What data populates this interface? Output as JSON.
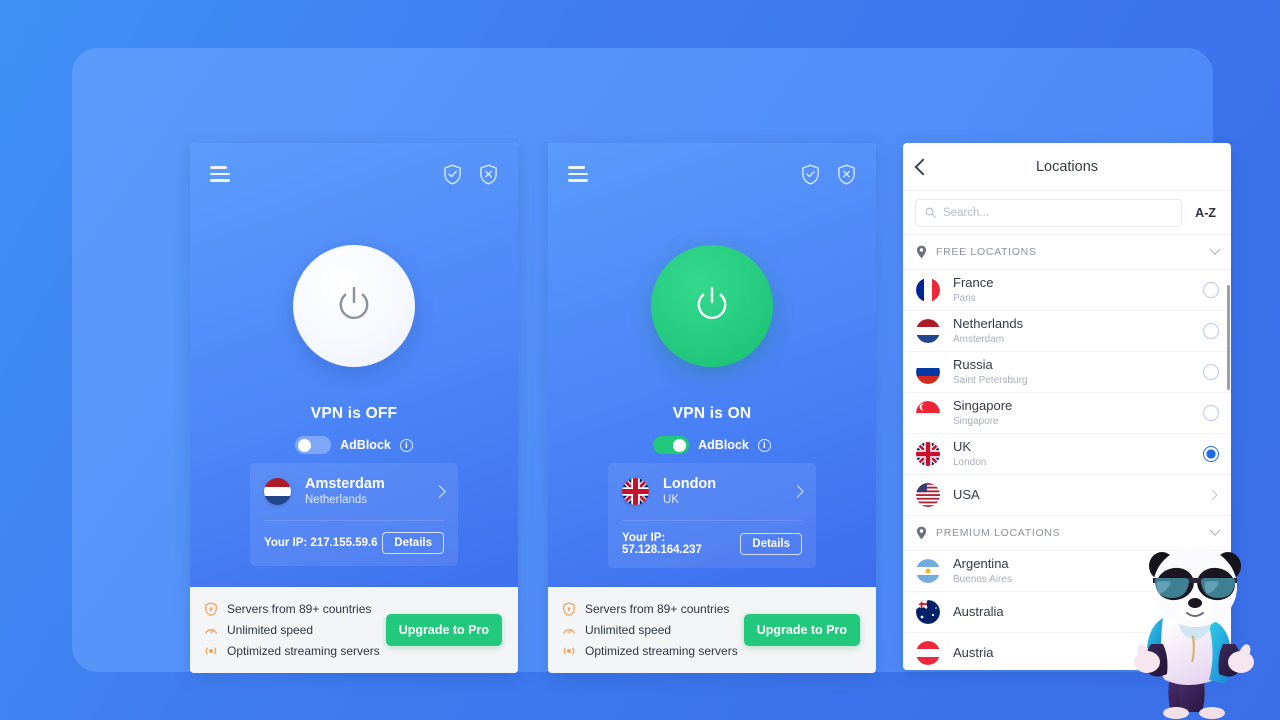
{
  "theme": {
    "page_bg_start": "#3f90f5",
    "page_bg_end": "#3b6fe8",
    "stage_bg": "#5390f9",
    "accent_green": "#22c97c",
    "accent_blue": "#1f6bef",
    "lock_red": "#e8525f",
    "perk_orange": "#f5a25d"
  },
  "panel_off": {
    "menu_icon": "hamburger-menu-icon",
    "shield_check_icon": "shield-check-icon",
    "shield_x_icon": "shield-x-icon",
    "power_icon": "power-icon",
    "power_state": "off",
    "status_text": "VPN is OFF",
    "adblock": {
      "label": "AdBlock",
      "enabled": false,
      "info_icon": "info-icon",
      "info_glyph": "i"
    },
    "server": {
      "flag": "netherlands-flag-icon",
      "city": "Amsterdam",
      "country": "Netherlands",
      "chevron_icon": "chevron-right-icon"
    },
    "ip_text": "Your IP: 217.155.59.6",
    "details_label": "Details",
    "upsell": {
      "perks": [
        {
          "icon": "shield-lock-icon",
          "label": "Servers from 89+ countries"
        },
        {
          "icon": "speedometer-icon",
          "label": "Unlimited speed"
        },
        {
          "icon": "stream-icon",
          "label": "Optimized streaming servers"
        }
      ],
      "upgrade_label": "Upgrade to Pro"
    }
  },
  "panel_on": {
    "menu_icon": "hamburger-menu-icon",
    "shield_check_icon": "shield-check-icon",
    "shield_x_icon": "shield-x-icon",
    "power_icon": "power-icon",
    "power_state": "on",
    "status_text": "VPN is ON",
    "adblock": {
      "label": "AdBlock",
      "enabled": true,
      "info_icon": "info-icon",
      "info_glyph": "i"
    },
    "server": {
      "flag": "uk-flag-icon",
      "city": "London",
      "country": "UK",
      "chevron_icon": "chevron-right-icon"
    },
    "ip_text": "Your IP: 57.128.164.237",
    "details_label": "Details",
    "upsell": {
      "perks": [
        {
          "icon": "shield-lock-icon",
          "label": "Servers from 89+ countries"
        },
        {
          "icon": "speedometer-icon",
          "label": "Unlimited speed"
        },
        {
          "icon": "stream-icon",
          "label": "Optimized streaming servers"
        }
      ],
      "upgrade_label": "Upgrade to Pro"
    }
  },
  "locations": {
    "back_icon": "back-chevron-icon",
    "title": "Locations",
    "search": {
      "icon": "search-icon",
      "value": "",
      "placeholder": "Search..."
    },
    "sort_label": "A-Z",
    "groups": [
      {
        "pin_icon": "location-pin-icon",
        "label": "FREE LOCATIONS",
        "expanded": true,
        "chevron_icon": "chevron-down-icon",
        "rows": [
          {
            "flag": "france-flag-icon",
            "name": "France",
            "city": "Paris",
            "control": "radio",
            "selected": false
          },
          {
            "flag": "netherlands-flag-icon",
            "name": "Netherlands",
            "city": "Amsterdam",
            "control": "radio",
            "selected": false
          },
          {
            "flag": "russia-flag-icon",
            "name": "Russia",
            "city": "Saint Petersburg",
            "control": "radio",
            "selected": false
          },
          {
            "flag": "singapore-flag-icon",
            "name": "Singapore",
            "city": "Singapore",
            "control": "radio",
            "selected": false
          },
          {
            "flag": "uk-flag-icon",
            "name": "UK",
            "city": "London",
            "control": "radio",
            "selected": true
          },
          {
            "flag": "usa-flag-icon",
            "name": "USA",
            "city": "",
            "control": "chevron",
            "selected": false
          }
        ]
      },
      {
        "pin_icon": "location-pin-icon",
        "label": "PREMIUM LOCATIONS",
        "expanded": true,
        "chevron_icon": "chevron-down-icon",
        "rows": [
          {
            "flag": "argentina-flag-icon",
            "name": "Argentina",
            "city": "Buenos Aires",
            "control": "lock",
            "selected": false
          },
          {
            "flag": "australia-flag-icon",
            "name": "Australia",
            "city": "",
            "control": "chevron",
            "selected": false
          },
          {
            "flag": "austria-flag-icon",
            "name": "Austria",
            "city": "",
            "control": "none",
            "selected": false
          }
        ]
      }
    ]
  },
  "mascot": {
    "name": "panda-mascot",
    "description": "3D panda with sunglasses and blue hoodie giving two thumbs up"
  }
}
